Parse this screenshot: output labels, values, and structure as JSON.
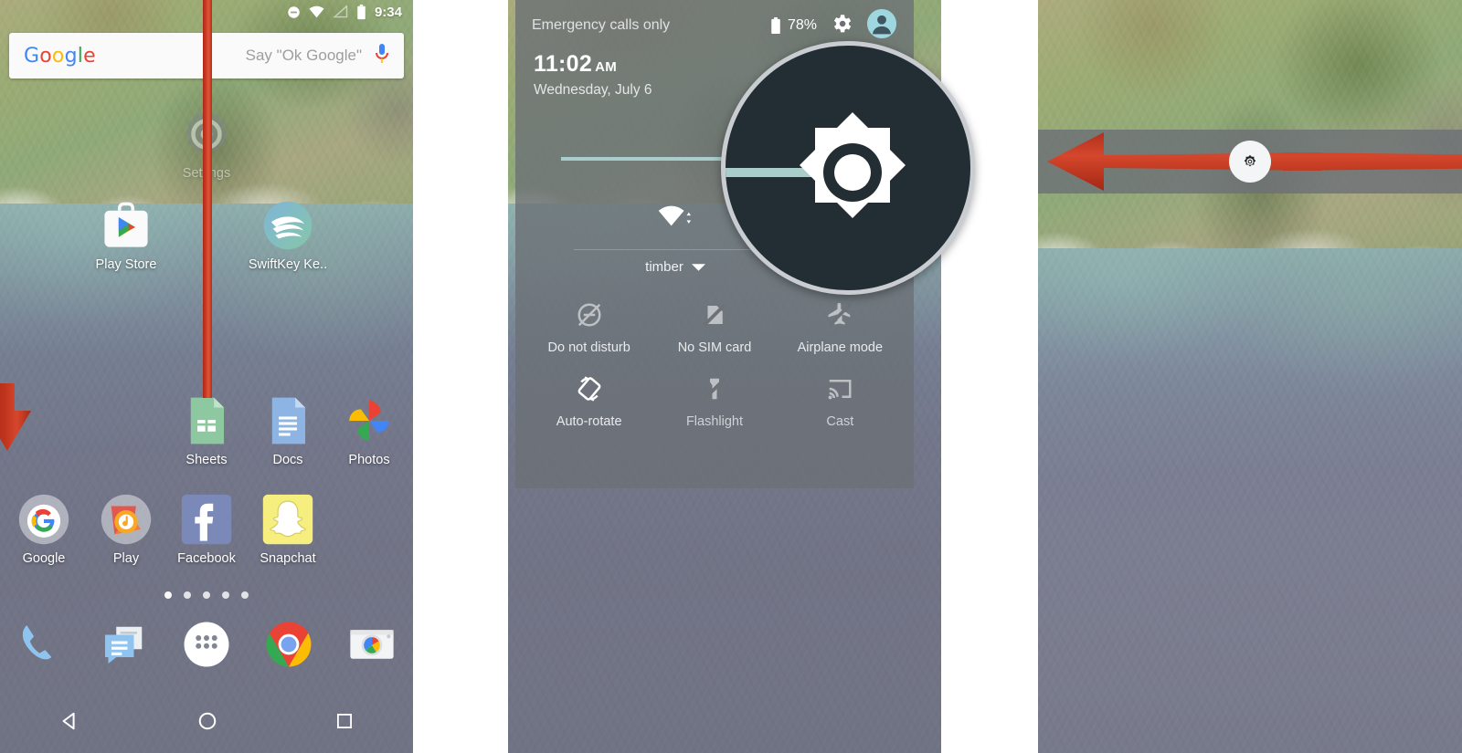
{
  "meta": {
    "accent_red": "#c0341d",
    "quick_settings_bg": "#6c7076",
    "brightness_fill": "#a8cdcb",
    "magnifier_bg": "#222e33"
  },
  "panel1": {
    "name": "home-screen",
    "status_bar": {
      "icons": [
        "do-not-disturb-icon",
        "wifi-icon",
        "signal-icon",
        "battery-icon"
      ],
      "time": "9:34"
    },
    "search": {
      "logo": "Google",
      "logo_letters": [
        "G",
        "o",
        "o",
        "g",
        "l",
        "e"
      ],
      "placeholder": "Say \"Ok Google\"",
      "mic_icon": "microphone-icon"
    },
    "apps_row1": [
      {
        "label": "Settings",
        "icon": "settings-gear-icon"
      }
    ],
    "apps_row2": [
      {
        "label": "Play Store",
        "icon": "play-store-icon"
      },
      {
        "label": "SwiftKey Ke..",
        "icon": "swiftkey-icon"
      }
    ],
    "apps_row3": [
      {
        "label": "Sheets",
        "icon": "google-sheets-icon"
      },
      {
        "label": "Docs",
        "icon": "google-docs-icon"
      },
      {
        "label": "Photos",
        "icon": "google-photos-icon"
      }
    ],
    "apps_row4": [
      {
        "label": "Google",
        "icon": "google-folder-icon"
      },
      {
        "label": "Play",
        "icon": "play-folder-icon"
      },
      {
        "label": "Facebook",
        "icon": "facebook-icon"
      },
      {
        "label": "Snapchat",
        "icon": "snapchat-icon"
      }
    ],
    "page_dots": 5,
    "page_active": 1,
    "dock": [
      {
        "label": "Phone",
        "icon": "phone-icon"
      },
      {
        "label": "Messages",
        "icon": "messages-icon"
      },
      {
        "label": "All apps",
        "icon": "app-drawer-icon"
      },
      {
        "label": "Chrome",
        "icon": "chrome-icon"
      },
      {
        "label": "Camera",
        "icon": "camera-icon"
      }
    ],
    "nav_bar": [
      {
        "label": "Back",
        "icon": "back-triangle-icon"
      },
      {
        "label": "Home",
        "icon": "home-circle-icon"
      },
      {
        "label": "Recents",
        "icon": "recents-square-icon"
      }
    ],
    "annotation": {
      "type": "arrow-down",
      "color": "#c0341d"
    }
  },
  "panel2": {
    "name": "quick-settings-shade",
    "carrier": "Emergency calls only",
    "battery_percent": "78%",
    "battery_icon": "battery-icon",
    "settings_icon": "gear-icon",
    "user_icon": "user-avatar-icon",
    "time": "11:02",
    "meridiem": "AM",
    "date": "Wednesday, July 6",
    "brightness": {
      "icon": "brightness-icon",
      "value_percent": 64
    },
    "wifi": {
      "icon": "wifi-icon",
      "ssid": "timber",
      "chevron": "chevron-down-icon"
    },
    "tiles": [
      {
        "label": "Do not disturb",
        "icon": "do-not-disturb-off-icon",
        "active": false
      },
      {
        "label": "No SIM card",
        "icon": "no-sim-card-icon",
        "active": false
      },
      {
        "label": "Airplane mode",
        "icon": "airplane-mode-icon",
        "active": false
      },
      {
        "label": "Auto-rotate",
        "icon": "auto-rotate-icon",
        "active": true
      },
      {
        "label": "Flashlight",
        "icon": "flashlight-off-icon",
        "active": false
      },
      {
        "label": "Cast",
        "icon": "cast-icon",
        "active": false
      }
    ],
    "magnifier": {
      "icon": "brightness-icon",
      "target": "brightness-slider"
    }
  },
  "panel3": {
    "name": "brightness-slider-closeup",
    "slider": {
      "knob_icon": "brightness-icon"
    },
    "annotations": [
      {
        "type": "arrow-left",
        "color": "#c0341d"
      },
      {
        "type": "arrow-right",
        "color": "#c0341d"
      }
    ]
  }
}
